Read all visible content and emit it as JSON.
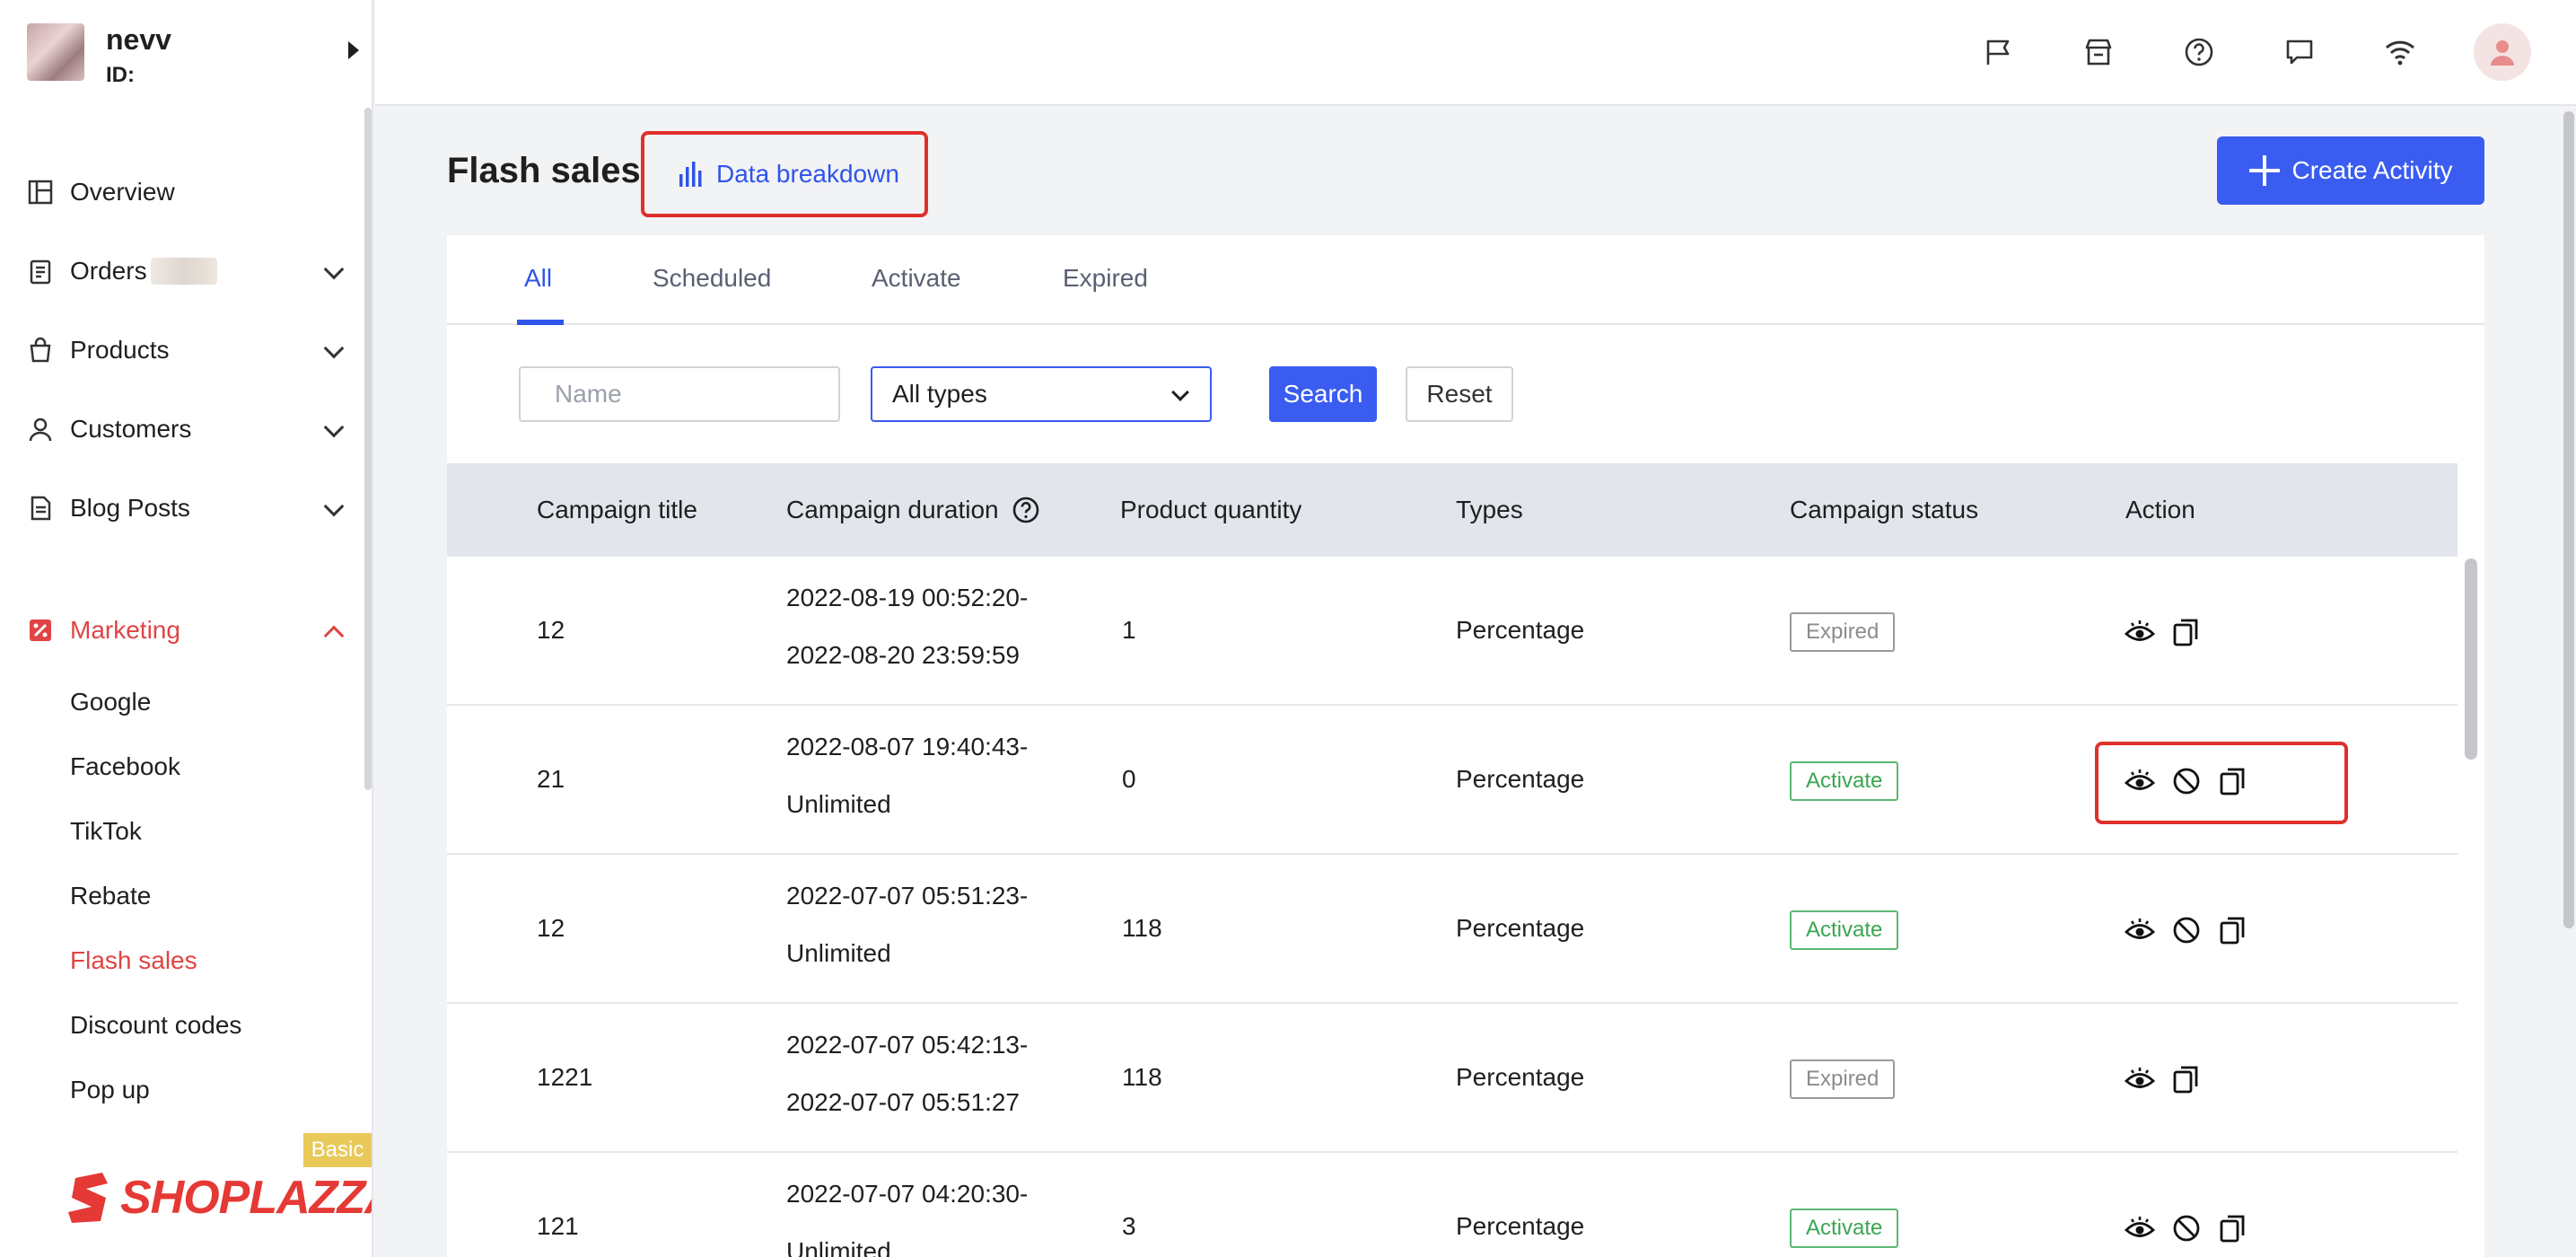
{
  "account": {
    "name": "nevv",
    "id_label": "ID:"
  },
  "sidebar": {
    "items": [
      {
        "label": "Overview",
        "icon": "overview-icon"
      },
      {
        "label": "Orders",
        "icon": "orders-icon"
      },
      {
        "label": "Products",
        "icon": "products-icon"
      },
      {
        "label": "Customers",
        "icon": "customers-icon"
      },
      {
        "label": "Blog Posts",
        "icon": "blog-posts-icon"
      },
      {
        "label": "Marketing",
        "icon": "marketing-icon"
      }
    ],
    "marketing_sub": [
      "Google",
      "Facebook",
      "TikTok",
      "Rebate",
      "Flash sales",
      "Discount codes",
      "Pop up"
    ],
    "plan_badge": "Basic",
    "brand": "SHOPLAZZA"
  },
  "topbar": {
    "icons": [
      "flag-icon",
      "store-icon",
      "help-icon",
      "chat-icon",
      "wifi-icon",
      "user-icon"
    ]
  },
  "page": {
    "title": "Flash sales",
    "data_breakdown": "Data breakdown",
    "create_button": "Create Activity"
  },
  "tabs": [
    "All",
    "Scheduled",
    "Activate",
    "Expired"
  ],
  "filters": {
    "name_placeholder": "Name",
    "type_value": "All types",
    "search_label": "Search",
    "reset_label": "Reset"
  },
  "table": {
    "headers": [
      "Campaign title",
      "Campaign duration",
      "Product quantity",
      "Types",
      "Campaign status",
      "Action"
    ],
    "rows": [
      {
        "title": "12",
        "start": "2022-08-19 00:52:20-",
        "end": "2022-08-20 23:59:59",
        "quantity": "1",
        "type": "Percentage",
        "status": "Expired"
      },
      {
        "title": "21",
        "start": "2022-08-07 19:40:43-",
        "end": "Unlimited",
        "quantity": "0",
        "type": "Percentage",
        "status": "Activate"
      },
      {
        "title": "12",
        "start": "2022-07-07 05:51:23-",
        "end": "Unlimited",
        "quantity": "118",
        "type": "Percentage",
        "status": "Activate"
      },
      {
        "title": "1221",
        "start": "2022-07-07 05:42:13-",
        "end": "2022-07-07 05:51:27",
        "quantity": "118",
        "type": "Percentage",
        "status": "Expired"
      },
      {
        "title": "121",
        "start": "2022-07-07 04:20:30-",
        "end": "Unlimited",
        "quantity": "3",
        "type": "Percentage",
        "status": "Activate"
      }
    ]
  },
  "colors": {
    "primary": "#3a5cf0",
    "accent_red": "#e04444",
    "active_green": "#3aa651",
    "expired_gray": "#8c8c8c"
  }
}
